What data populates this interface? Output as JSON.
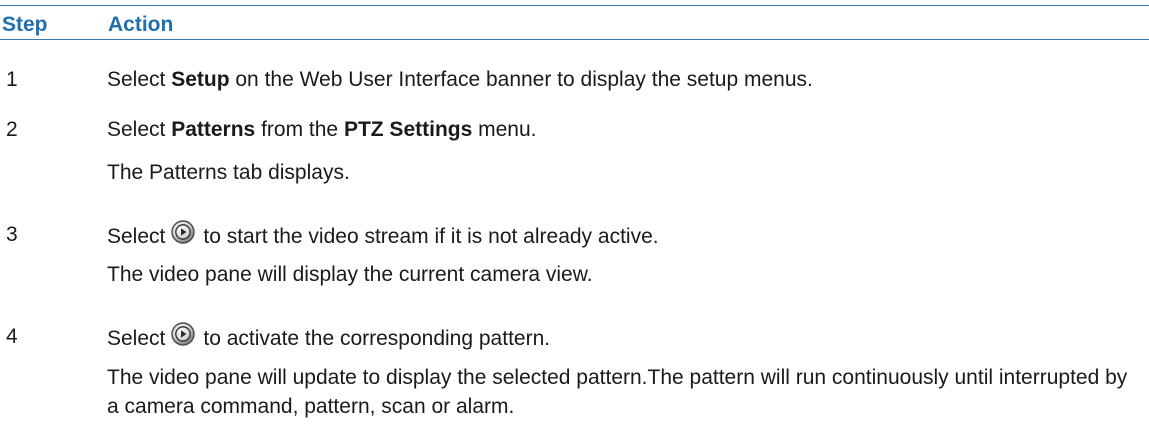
{
  "header": {
    "step": "Step",
    "action": "Action"
  },
  "steps": [
    {
      "number": "1",
      "pre": "Select ",
      "bold1": "Setup",
      "post": " on the Web User Interface banner to display the setup menus."
    },
    {
      "number": "2",
      "pre": "Select ",
      "bold1": "Patterns",
      "mid": " from the ",
      "bold2": "PTZ Settings",
      "post": " menu.",
      "note": "The Patterns tab displays."
    },
    {
      "number": "3",
      "pre": "Select",
      "icon": "play-circle-icon",
      "post": "to start the video stream if it is not already active.",
      "note": "The video pane will display the current camera view."
    },
    {
      "number": "4",
      "pre": "Select",
      "icon": "play-circle-icon",
      "post": "to activate the corresponding pattern.",
      "note": "The video pane will update to display the selected pattern.The pattern will run continuously until interrupted by a camera command, pattern, scan or alarm."
    }
  ]
}
